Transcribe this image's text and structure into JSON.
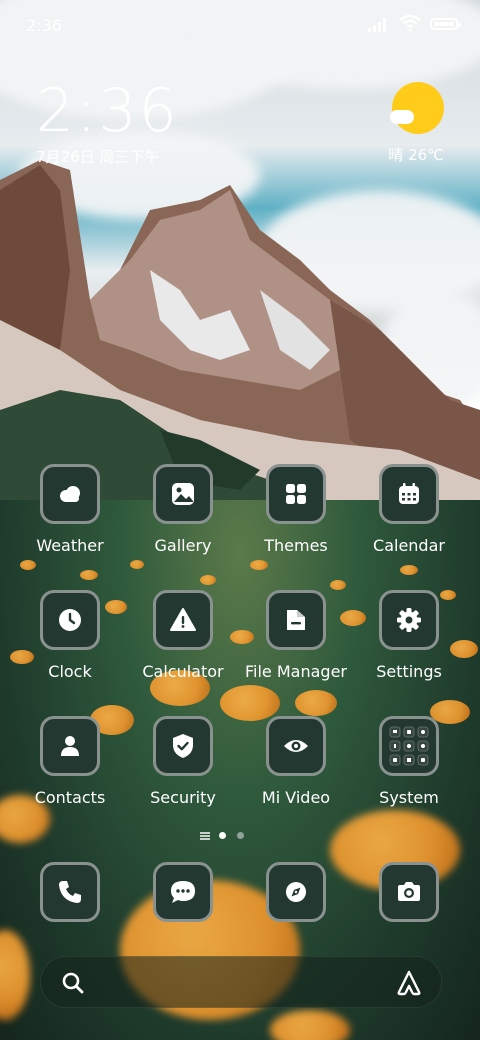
{
  "status_bar": {
    "time": "2:36"
  },
  "clock_widget": {
    "time": "2:36",
    "date": "7月26日 周三下午"
  },
  "weather_widget": {
    "text": "晴 26℃"
  },
  "apps": [
    {
      "label": "Weather",
      "icon": "weather-icon"
    },
    {
      "label": "Gallery",
      "icon": "gallery-icon"
    },
    {
      "label": "Themes",
      "icon": "themes-icon"
    },
    {
      "label": "Calendar",
      "icon": "calendar-icon"
    },
    {
      "label": "Clock",
      "icon": "clock-icon"
    },
    {
      "label": "Calculator",
      "icon": "calculator-icon"
    },
    {
      "label": "File Manager",
      "icon": "file-manager-icon"
    },
    {
      "label": "Settings",
      "icon": "settings-icon"
    },
    {
      "label": "Contacts",
      "icon": "contacts-icon"
    },
    {
      "label": "Security",
      "icon": "security-icon"
    },
    {
      "label": "Mi Video",
      "icon": "mi-video-icon"
    },
    {
      "label": "System",
      "icon": "system-folder-icon"
    }
  ],
  "dock": [
    {
      "icon": "phone-icon"
    },
    {
      "icon": "messages-icon"
    },
    {
      "icon": "browser-icon"
    },
    {
      "icon": "camera-icon"
    }
  ],
  "pager": {
    "pages": 2,
    "current": 1
  },
  "colors": {
    "icon_bg": "#243832",
    "icon_border": "#8a9290",
    "icon_glyph": "#ffffff",
    "sun": "#ffcc1a"
  }
}
